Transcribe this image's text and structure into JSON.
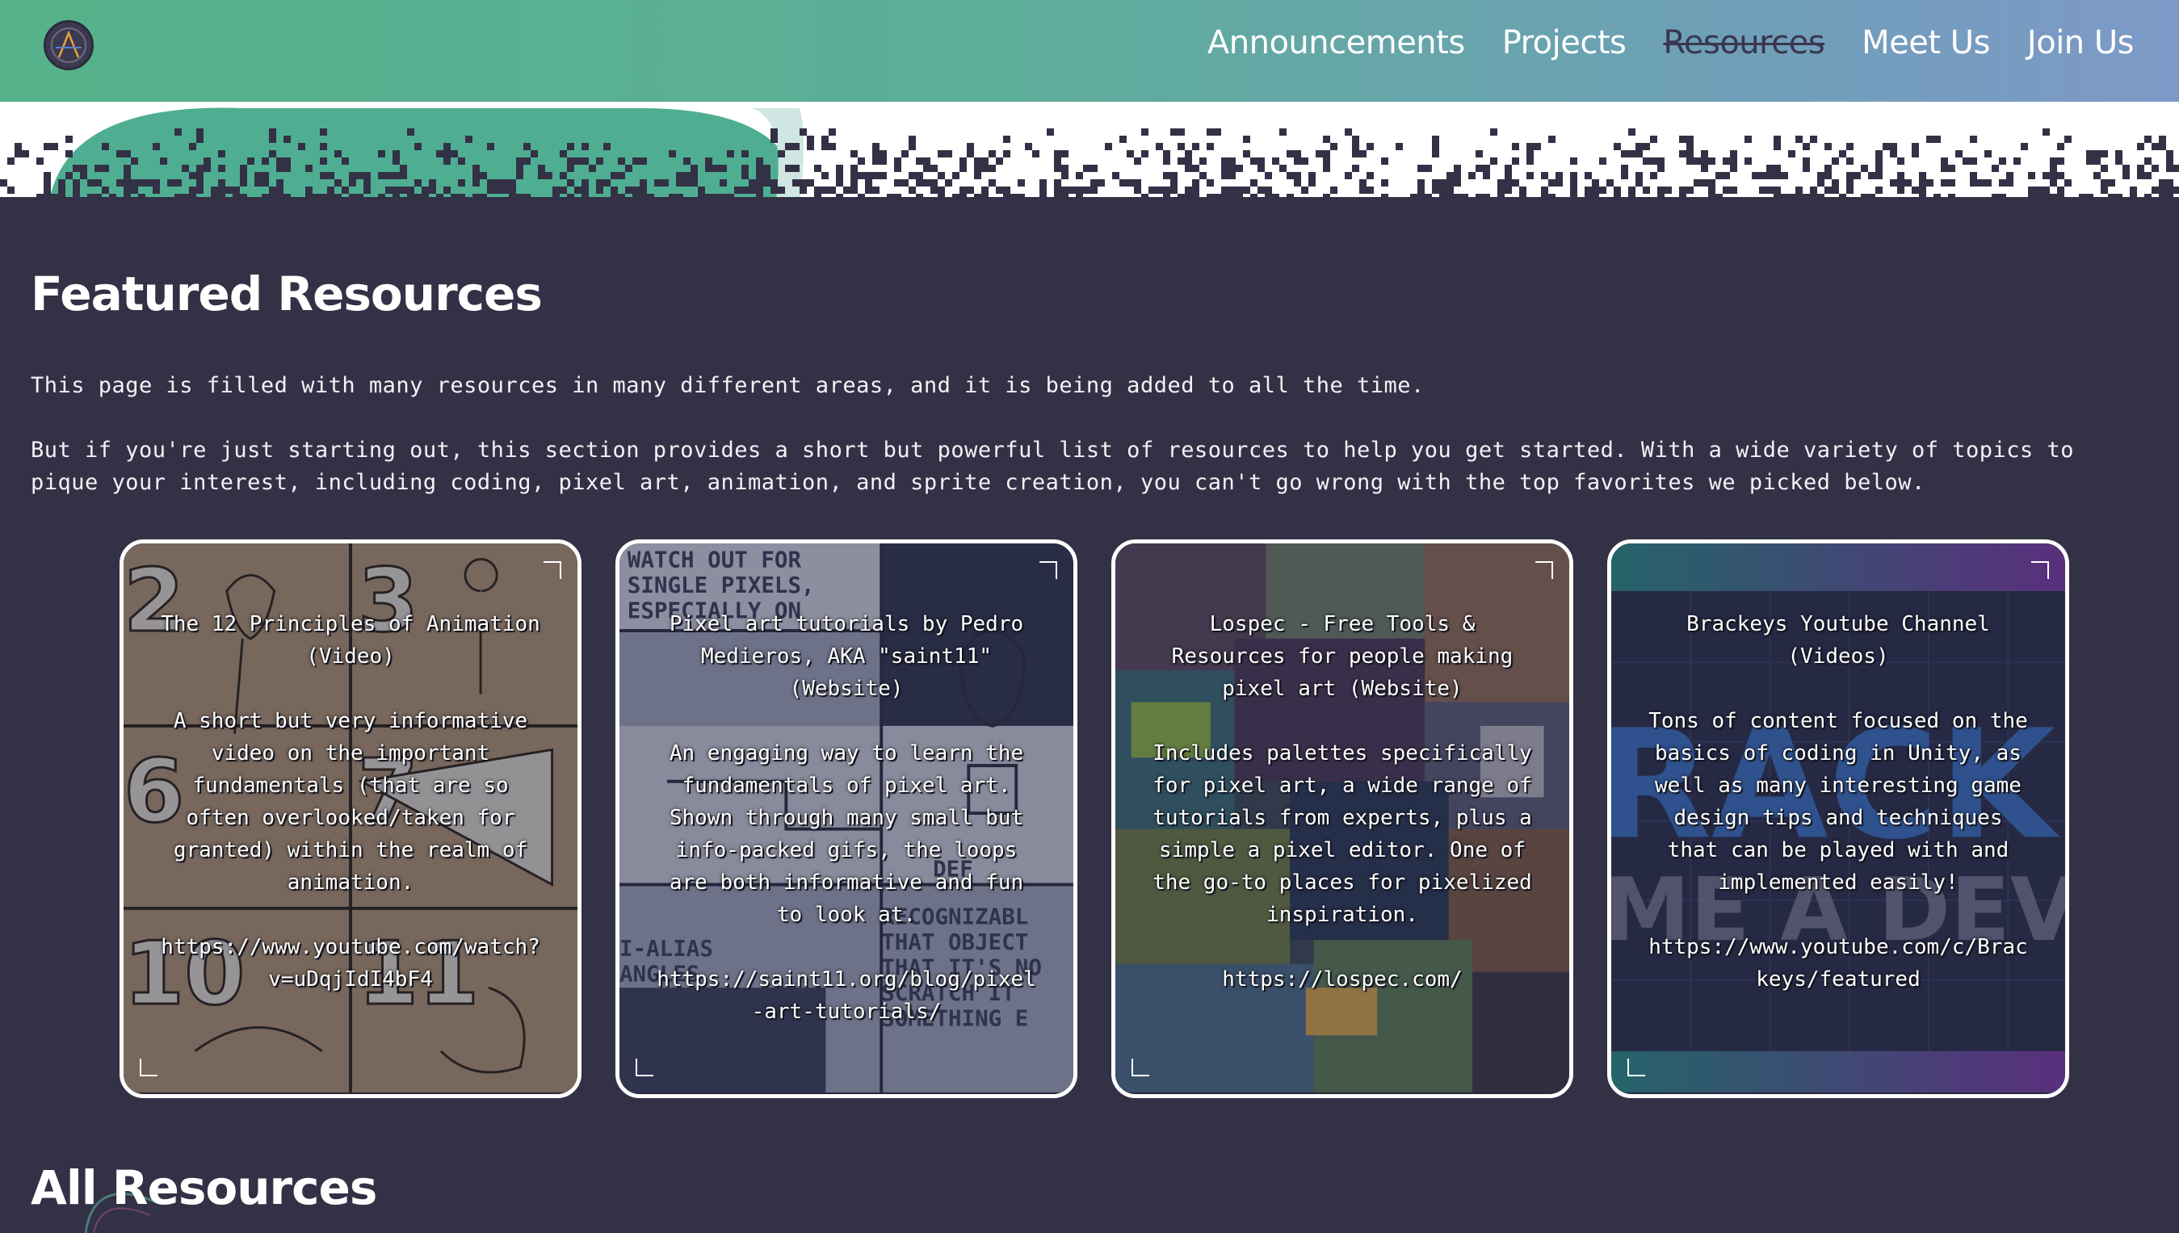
{
  "nav": {
    "logo_icon": "a-monogram-logo",
    "items": [
      {
        "label": "Announcements",
        "active": false
      },
      {
        "label": "Projects",
        "active": false
      },
      {
        "label": "Resources",
        "active": true
      },
      {
        "label": "Meet Us",
        "active": false
      },
      {
        "label": "Join Us",
        "active": false
      }
    ]
  },
  "featured": {
    "title": "Featured Resources",
    "intro": "This page is filled with many resources in many different areas, and it is being added to all the time.",
    "intro2": "But if you're just starting out, this section provides a short but powerful list of resources to help you get started. With a wide variety of topics to pique your interest, including coding, pixel art, animation, and sprite creation, you can't go wrong with the top favorites we picked below."
  },
  "cards": [
    {
      "title": "The 12 Principles of Animation (Video)",
      "description": "A short but very informative video on the important fundamentals (that are so often overlooked/taken for granted) within the realm of animation.",
      "url": "https://www.youtube.com/watch?v=uDqjIdI4bF4"
    },
    {
      "title": "Pixel art tutorials by Pedro Medieros, AKA \"saint11\" (Website)",
      "description": "An engaging way to learn the fundamentals of pixel art. Shown through many small but info-packed gifs, the loops are both informative and fun to look at.",
      "url": "https://saint11.org/blog/pixel-art-tutorials/"
    },
    {
      "title": "Lospec - Free Tools & Resources for people making pixel art (Website)",
      "description": "Includes palettes specifically for pixel art, a wide range of tutorials from experts, plus a simple a pixel editor. One of the go-to places for pixelized inspiration.",
      "url": "https://lospec.com/"
    },
    {
      "title": "Brackeys Youtube Channel (Videos)",
      "description": "Tons of content focused on the basics of coding in Unity, as well as many interesting game design tips and techniques that can be played with and implemented easily!",
      "url": "https://www.youtube.com/c/Brackeys/featured"
    }
  ],
  "all": {
    "title": "All Resources"
  },
  "colors": {
    "background": "#333145",
    "header_start": "#56b28a",
    "header_end": "#7e99c8"
  }
}
